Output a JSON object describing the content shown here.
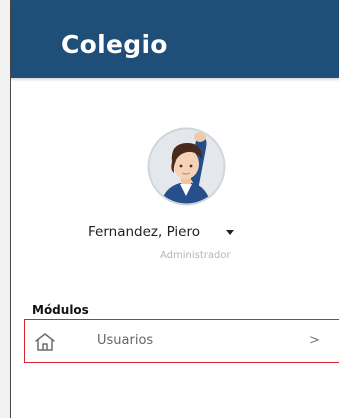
{
  "header": {
    "title": "Colegio",
    "background_color": "#1f4e79"
  },
  "user": {
    "name": "Fernandez, Piero",
    "role": "Administrador",
    "avatar_icon": "user-avatar-icon",
    "dropdown_icon": "caret-down-icon"
  },
  "menu": {
    "section_label": "Módulos",
    "items": [
      {
        "label": "Usuarios",
        "icon": "home-icon",
        "chevron": ">",
        "highlight_color": "#d9232d"
      }
    ]
  }
}
